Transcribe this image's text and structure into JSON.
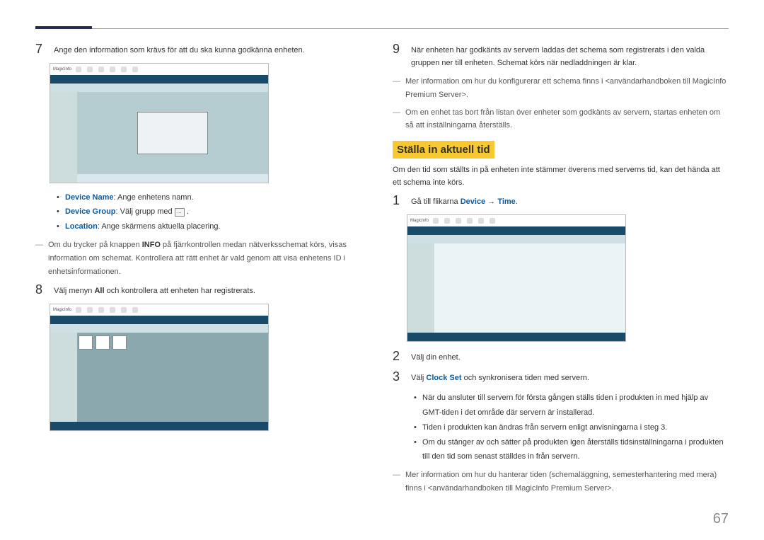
{
  "left": {
    "step7": "Ange den information som krävs för att du ska kunna godkänna enheten.",
    "b1_label": "Device Name",
    "b1_text": ": Ange enhetens namn.",
    "b2_label": "Device Group",
    "b2_text": ": Välj grupp med ",
    "b3_label": "Location",
    "b3_text": ": Ange skärmens aktuella placering.",
    "note_a": "Om du trycker på knappen ",
    "note_b": "INFO",
    "note_c": " på fjärrkontrollen medan nätverksschemat körs, visas information om schemat. Kontrollera att rätt enhet är vald genom att visa enhetens ID i enhetsinformationen.",
    "step8_a": "Välj menyn ",
    "step8_b": "All",
    "step8_c": " och kontrollera att enheten har registrerats."
  },
  "right": {
    "step9": "När enheten har godkänts av servern laddas det schema som registrerats i den valda gruppen ner till enheten. Schemat körs när nedladdningen är klar.",
    "note1": "Mer information om hur du konfigurerar ett schema finns i <användarhandboken till MagicInfo Premium Server>.",
    "note2": "Om en enhet tas bort från listan över enheter som godkänts av servern, startas enheten om så att inställningarna återställs.",
    "heading": "Ställa in aktuell tid",
    "intro": "Om den tid som ställts in på enheten inte stämmer överens med serverns tid, kan det hända att ett schema inte körs.",
    "step1_a": "Gå till flikarna ",
    "step1_b": "Device",
    "step1_arrow": " → ",
    "step1_c": "Time",
    "step1_d": ".",
    "step2": "Välj din enhet.",
    "step3_a": "Välj ",
    "step3_b": "Clock Set",
    "step3_c": " och synkronisera tiden med servern.",
    "b1": "När du ansluter till servern för första gången ställs tiden i produkten in med hjälp av GMT-tiden i det område där servern är installerad.",
    "b2": "Tiden i produkten kan ändras från servern enligt anvisningarna i steg 3.",
    "b3": "Om du stänger av och sätter på produkten igen återställs tidsinställningarna i produkten till den tid som senast ställdes in från servern.",
    "note3": "Mer information om hur du hanterar tiden (schemaläggning, semesterhantering med mera) finns i <användarhandboken till MagicInfo Premium Server>."
  },
  "pagenum": "67",
  "browse_btn": "..."
}
